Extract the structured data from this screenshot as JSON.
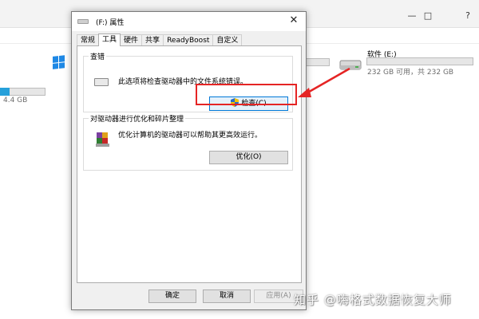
{
  "background": {
    "window_controls": [
      "—",
      "□",
      "?"
    ],
    "drive_c": {
      "size_text": "4.4 GB",
      "used_fraction": 0.2
    },
    "drive_e": {
      "name": "软件 (E:)",
      "size_text": "232 GB 可用，共 232 GB",
      "used_fraction": 0.0
    }
  },
  "dialog": {
    "title": "(F:) 属性",
    "close_icon": "close-icon",
    "tabs": [
      {
        "label": "常规"
      },
      {
        "label": "工具"
      },
      {
        "label": "硬件"
      },
      {
        "label": "共享"
      },
      {
        "label": "ReadyBoost"
      },
      {
        "label": "自定义"
      }
    ],
    "active_tab": "工具",
    "error_check": {
      "title": "查错",
      "description": "此选项将检查驱动器中的文件系统错误。",
      "button": "检查(C)"
    },
    "optimize": {
      "title": "对驱动器进行优化和碎片整理",
      "description": "优化计算机的驱动器可以帮助其更高效运行。",
      "button": "优化(O)"
    },
    "footer": {
      "ok": "确定",
      "cancel": "取消",
      "apply": "应用(A)"
    }
  },
  "annotation": {
    "color": "#e52424"
  },
  "watermark": "知乎 @嗨格式数据恢复大师"
}
